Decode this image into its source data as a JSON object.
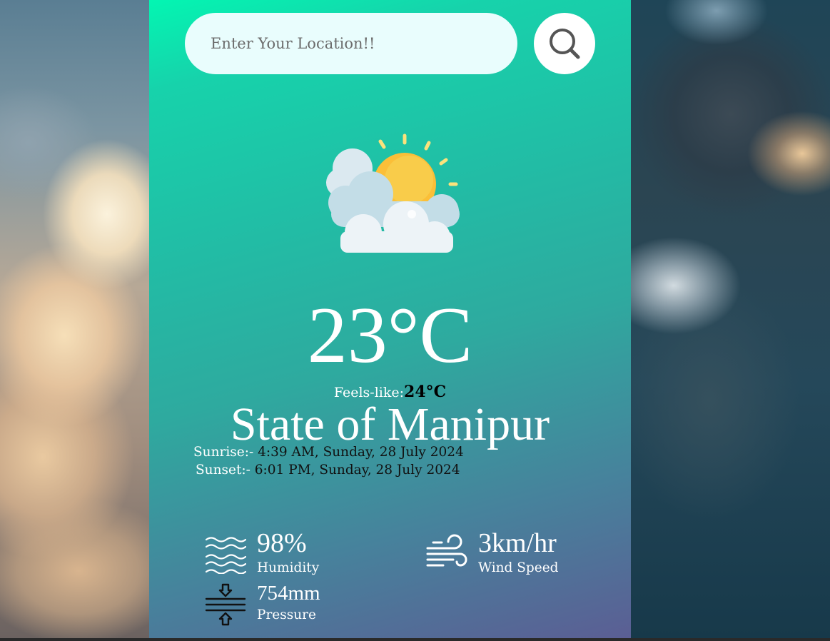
{
  "search": {
    "placeholder": "Enter Your Location!!",
    "icon": "search-icon"
  },
  "weather": {
    "icon": "partly-cloudy-icon",
    "temperature": "23°C",
    "feels_like_label": "Feels-like:",
    "feels_like_value": "24°C",
    "location": "State of Manipur",
    "sunrise_label": "Sunrise:-",
    "sunrise_value": "4:39 AM, Sunday, 28 July 2024",
    "sunset_label": "Sunset:-",
    "sunset_value": "6:01 PM, Sunday, 28 July 2024"
  },
  "stats": {
    "humidity_value": "98%",
    "humidity_label": "Humidity",
    "wind_value": "3km/hr",
    "wind_label": "Wind Speed",
    "pressure_value": "754mm",
    "pressure_label": "Pressure"
  },
  "colors": {
    "card_top": "#03f6b2",
    "card_bottom": "#5b5e94",
    "search_bg": "#e9fdfd",
    "sun": "#fbbf38"
  }
}
